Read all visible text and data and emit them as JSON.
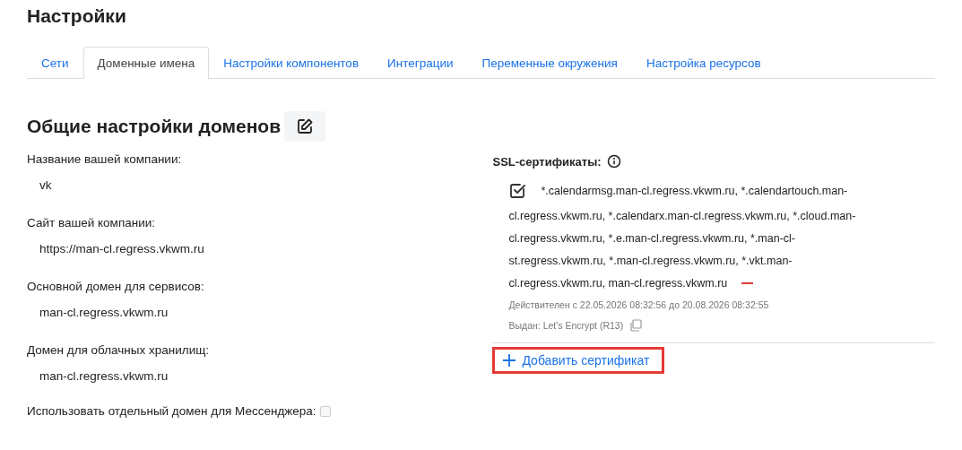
{
  "title": "Настройки",
  "tabs": [
    {
      "label": "Сети",
      "selected": false
    },
    {
      "label": "Доменные имена",
      "selected": true
    },
    {
      "label": "Настройки компонентов",
      "selected": false
    },
    {
      "label": "Интеграции",
      "selected": false
    },
    {
      "label": "Переменные окружения",
      "selected": false
    },
    {
      "label": "Настройка ресурсов",
      "selected": false
    }
  ],
  "section_title": "Общие настройки доменов",
  "fields": [
    {
      "label": "Название вашей компании:",
      "value": "vk"
    },
    {
      "label": "Сайт вашей компании:",
      "value": "https://man-cl.regress.vkwm.ru"
    },
    {
      "label": "Основной домен для сервисов:",
      "value": "man-cl.regress.vkwm.ru"
    },
    {
      "label": "Домен для облачных хранилищ:",
      "value": "man-cl.regress.vkwm.ru"
    }
  ],
  "messenger_option": {
    "label": "Использовать отдельный домен для Мессенджера:",
    "checked": false
  },
  "ssl": {
    "label": "SSL-сертификаты:",
    "certificate": {
      "domain_lines": [
        "*.calendarmsg.man-cl.regress.vkwm.ru, *.calendartouch.man-",
        "cl.regress.vkwm.ru, *.calendarx.man-cl.regress.vkwm.ru, *.cloud.man-",
        "cl.regress.vkwm.ru, *.e.man-cl.regress.vkwm.ru, *.man-cl-",
        "st.regress.vkwm.ru, *.man-cl.regress.vkwm.ru, *.vkt.man-",
        "cl.regress.vkwm.ru, man-cl.regress.vkwm.ru"
      ],
      "validity": "Действителен с 22.05.2026 08:32:56 до 20.08.2026 08:32:55",
      "issuer": "Выдан: Let's Encrypt (R13)"
    },
    "add_button": "Добавить сертификат"
  }
}
